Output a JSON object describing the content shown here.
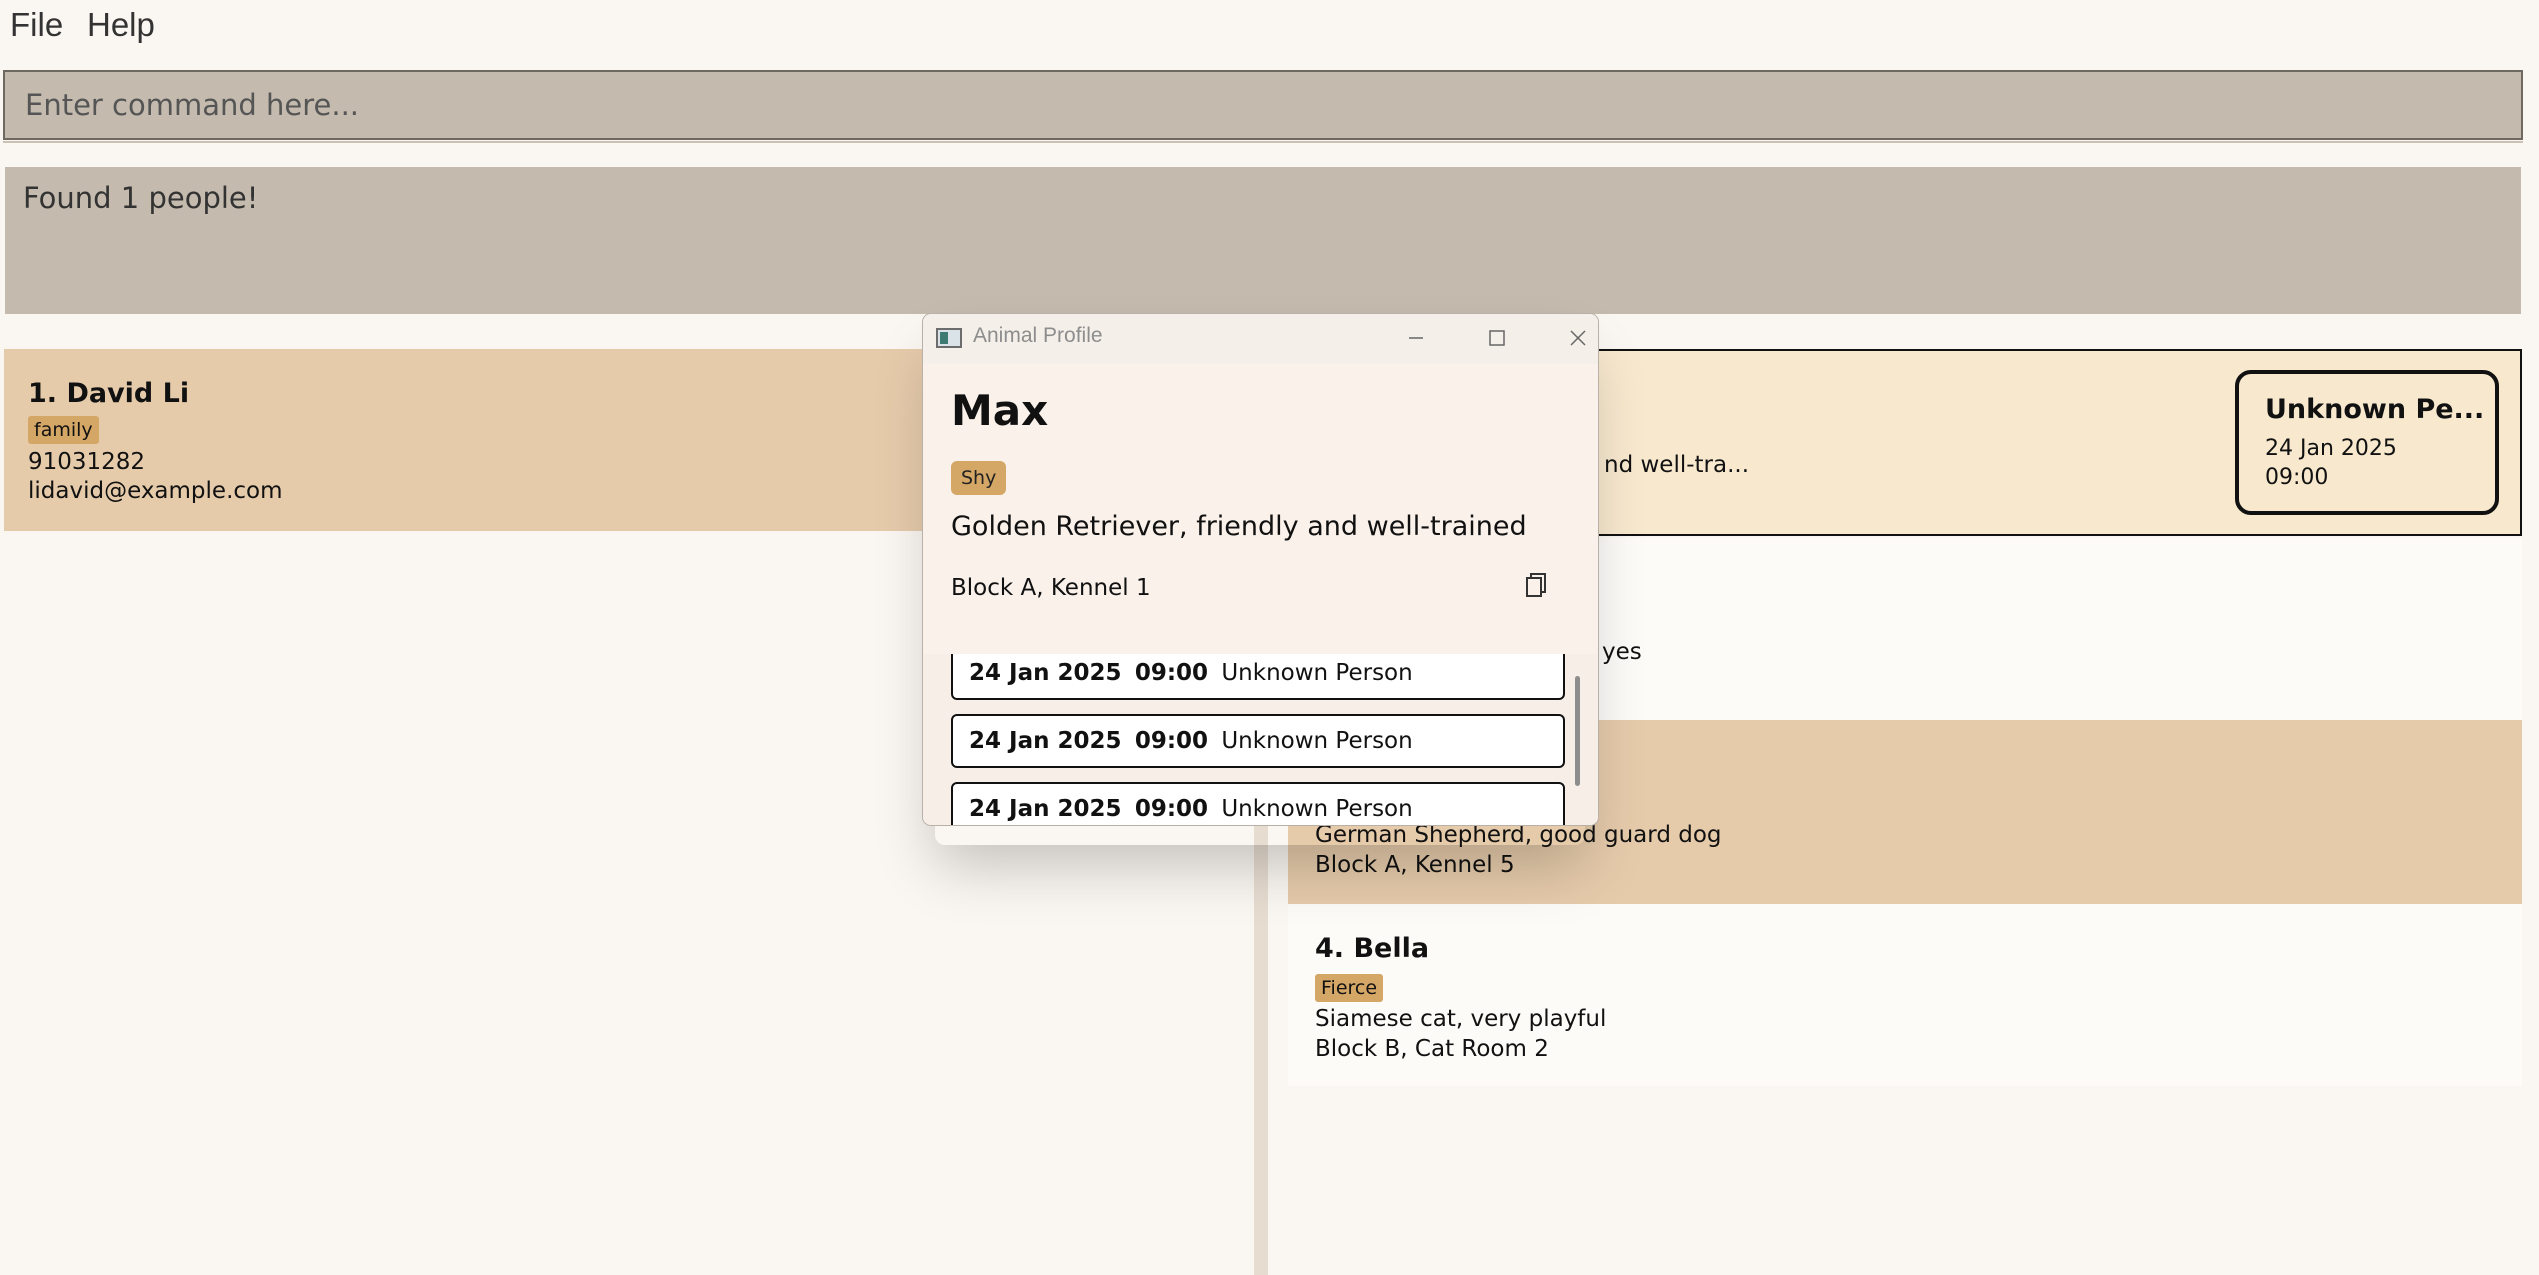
{
  "menu": {
    "file": "File",
    "help": "Help"
  },
  "command": {
    "placeholder": "Enter command here..."
  },
  "result": {
    "text": "Found 1 people!"
  },
  "persons": [
    {
      "title": "1. David Li",
      "tag": "family",
      "phone": "91031282",
      "email": "lidavid@example.com"
    }
  ],
  "animals": [
    {
      "desc_partial": "nd well-tra...",
      "appointment": {
        "title": "Unknown Pe...",
        "date": "24 Jan 2025",
        "time": "09:00"
      }
    },
    {
      "desc_partial": "yes"
    },
    {
      "description": "German Shepherd, good guard dog",
      "location": "Block A, Kennel 5"
    },
    {
      "title": "4. Bella",
      "tag": "Fierce",
      "description": "Siamese cat, very playful",
      "location": "Block B, Cat Room 2"
    }
  ],
  "popup": {
    "window_title": "Animal Profile",
    "name": "Max",
    "tag": "Shy",
    "description": "Golden Retriever, friendly and well-trained",
    "location": "Block A, Kennel 1",
    "appointments": [
      {
        "date": "24 Jan 2025",
        "time": "09:00",
        "person": "Unknown Person"
      },
      {
        "date": "24 Jan 2025",
        "time": "09:00",
        "person": "Unknown Person"
      },
      {
        "date": "24 Jan 2025",
        "time": "09:00",
        "person": "Unknown Person"
      }
    ]
  },
  "icons": {
    "minimize": "minimize-icon",
    "maximize": "maximize-icon",
    "close": "close-icon",
    "copy": "copy-icon",
    "app": "app-window-icon"
  },
  "colors": {
    "background": "#faf6f1",
    "command_bg": "#c4bbae",
    "card_selected": "#e6cbab",
    "card_highlight": "#f7e8ce",
    "tag": "#d4a766"
  }
}
